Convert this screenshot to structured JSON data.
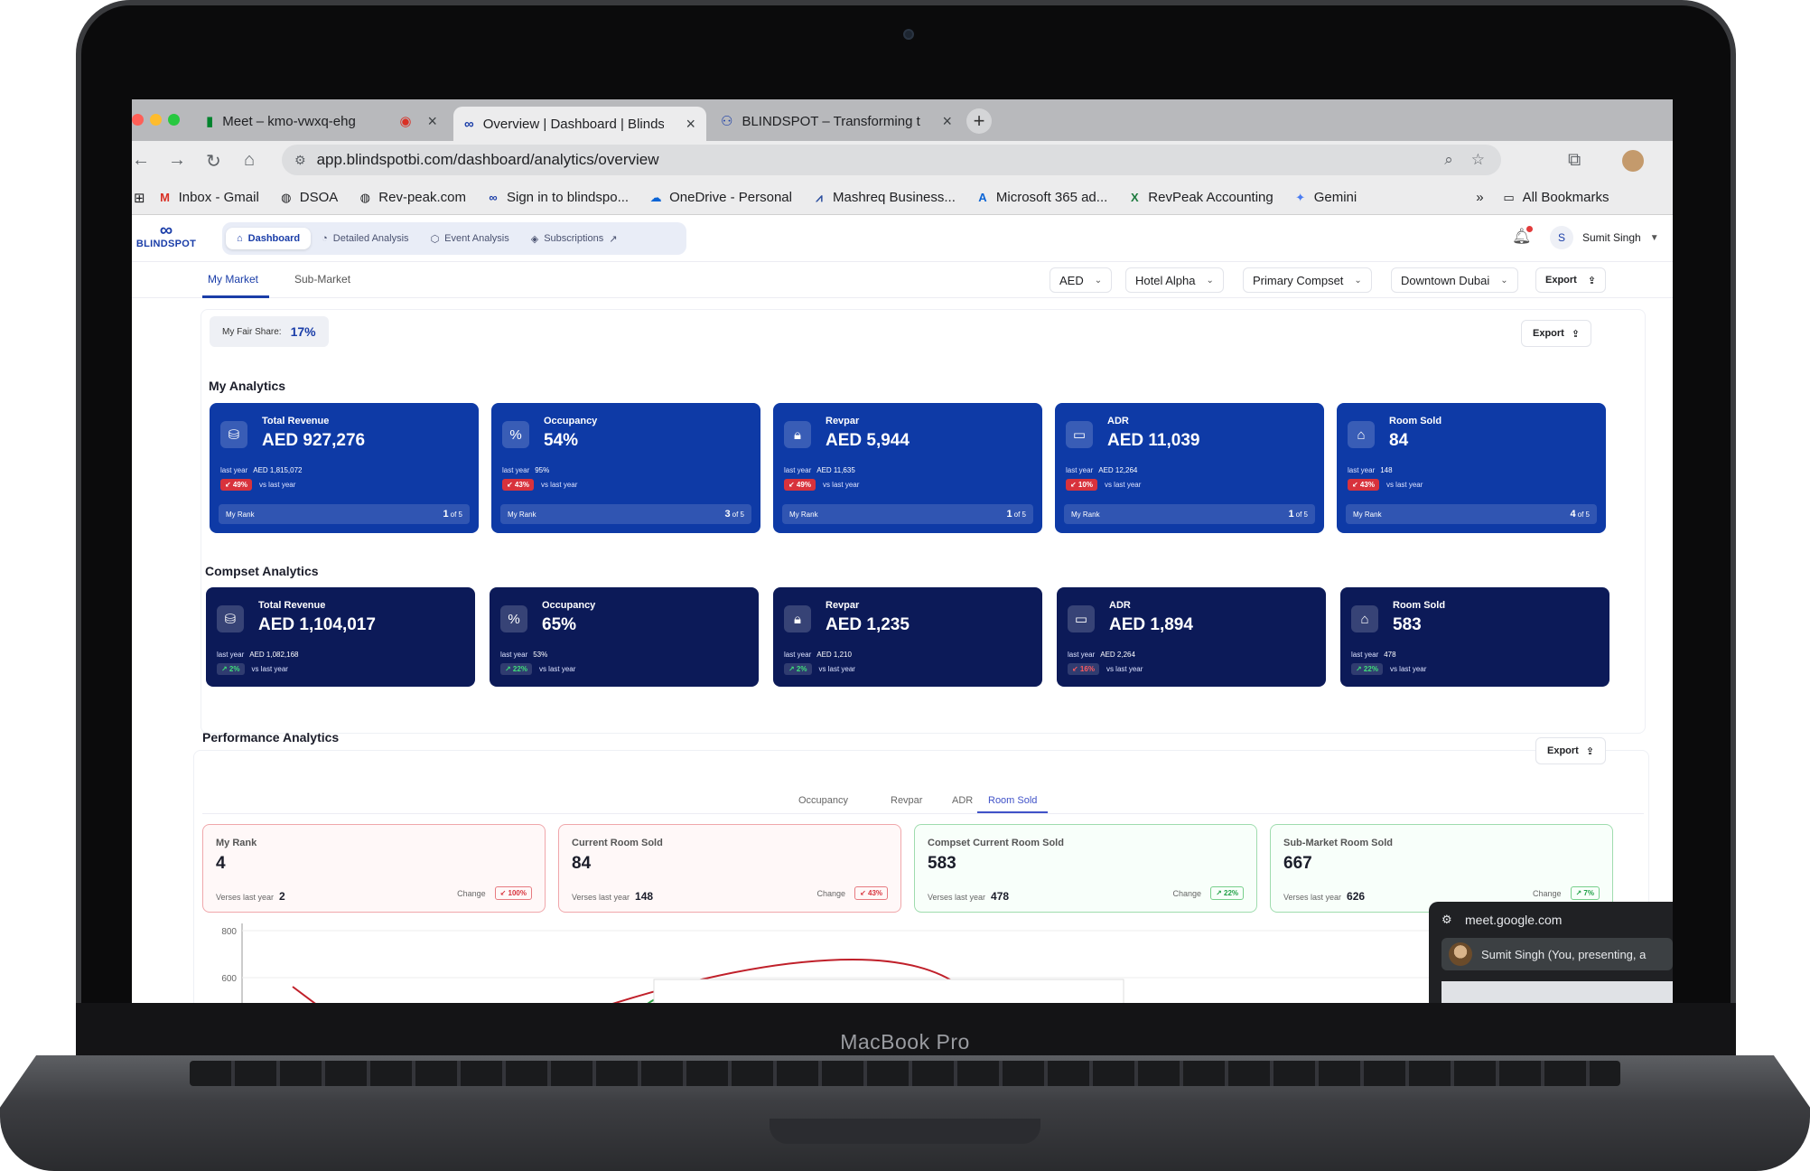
{
  "device": {
    "brand": "MacBook Pro"
  },
  "browser": {
    "tabs": [
      {
        "title": "Meet – kmo-vwxq-ehg",
        "icon": "google-meet-icon"
      },
      {
        "title": "Overview | Dashboard | Blinds",
        "icon": "blindspot-icon"
      },
      {
        "title": "BLINDSPOT – Transforming t",
        "icon": "people-icon"
      }
    ],
    "url": "app.blindspotbi.com/dashboard/analytics/overview",
    "bookmarks": [
      "Inbox - Gmail",
      "DSOA",
      "Rev-peak.com",
      "Sign in to blindspo...",
      "OneDrive - Personal",
      "Mashreq Business...",
      "Microsoft 365 ad...",
      "RevPeak Accounting",
      "Gemini"
    ],
    "all_bookmarks": "All Bookmarks"
  },
  "app": {
    "logo": "BLINDSPOT",
    "nav": [
      "Dashboard",
      "Detailed Analysis",
      "Event Analysis",
      "Subscriptions"
    ],
    "user": {
      "initial": "S",
      "name": "Sumit Singh"
    },
    "subtabs": [
      "My Market",
      "Sub-Market"
    ],
    "filters": [
      "AED",
      "Hotel Alpha",
      "Primary Compset",
      "Downtown Dubai"
    ],
    "export": "Export",
    "fair_share_label": "My Fair Share:",
    "fair_share_value": "17%",
    "colors": {
      "primary": "#0e3aa6",
      "navy": "#0c1a58",
      "red": "#d8323c",
      "green": "#20a046"
    }
  },
  "my_analytics": {
    "title": "My Analytics",
    "cards": [
      {
        "label": "Total Revenue",
        "value": "AED 927,276",
        "ly_label": "last year",
        "ly_value": "AED 1,815,072",
        "change": "↙ 49%",
        "vs": "vs last year",
        "rank_label": "My Rank",
        "rank": "1",
        "rank_of": "of 5",
        "icon": "money-bag-icon"
      },
      {
        "label": "Occupancy",
        "value": "54%",
        "ly_label": "last year",
        "ly_value": "95%",
        "change": "↙ 43%",
        "vs": "vs last year",
        "rank_label": "My Rank",
        "rank": "3",
        "rank_of": "of 5",
        "icon": "percent-icon"
      },
      {
        "label": "Revpar",
        "value": "AED 5,944",
        "ly_label": "last year",
        "ly_value": "AED 11,635",
        "change": "↙ 49%",
        "vs": "vs last year",
        "rank_label": "My Rank",
        "rank": "1",
        "rank_of": "of 5",
        "icon": "bag-icon"
      },
      {
        "label": "ADR",
        "value": "AED 11,039",
        "ly_label": "last year",
        "ly_value": "AED 12,264",
        "change": "↙ 10%",
        "vs": "vs last year",
        "rank_label": "My Rank",
        "rank": "1",
        "rank_of": "of 5",
        "icon": "wallet-icon"
      },
      {
        "label": "Room Sold",
        "value": "84",
        "ly_label": "last year",
        "ly_value": "148",
        "change": "↙ 43%",
        "vs": "vs last year",
        "rank_label": "My Rank",
        "rank": "4",
        "rank_of": "of 5",
        "icon": "hotel-icon"
      }
    ]
  },
  "compset_analytics": {
    "title": "Compset Analytics",
    "cards": [
      {
        "label": "Total Revenue",
        "value": "AED 1,104,017",
        "ly_label": "last year",
        "ly_value": "AED 1,082,168",
        "change": "↗ 2%",
        "trend": "up",
        "vs": "vs last year",
        "icon": "money-bag-icon"
      },
      {
        "label": "Occupancy",
        "value": "65%",
        "ly_label": "last year",
        "ly_value": "53%",
        "change": "↗ 22%",
        "trend": "up",
        "vs": "vs last year",
        "icon": "percent-icon"
      },
      {
        "label": "Revpar",
        "value": "AED 1,235",
        "ly_label": "last year",
        "ly_value": "AED 1,210",
        "change": "↗ 2%",
        "trend": "up",
        "vs": "vs last year",
        "icon": "bag-icon"
      },
      {
        "label": "ADR",
        "value": "AED 1,894",
        "ly_label": "last year",
        "ly_value": "AED 2,264",
        "change": "↙ 16%",
        "trend": "down",
        "vs": "vs last year",
        "icon": "wallet-icon"
      },
      {
        "label": "Room Sold",
        "value": "583",
        "ly_label": "last year",
        "ly_value": "478",
        "change": "↗ 22%",
        "trend": "up",
        "vs": "vs last year",
        "icon": "hotel-icon"
      }
    ]
  },
  "performance": {
    "title": "Performance Analytics",
    "tabs": [
      "Occupancy",
      "Revpar",
      "ADR",
      "Room Sold"
    ],
    "active_tab": "Room Sold",
    "cards": [
      {
        "label": "My Rank",
        "value": "4",
        "vs_label": "Verses last year",
        "vs_value": "2",
        "change_label": "Change",
        "change": "↙ 100%",
        "tone": "red"
      },
      {
        "label": "Current Room Sold",
        "value": "84",
        "vs_label": "Verses last year",
        "vs_value": "148",
        "change_label": "Change",
        "change": "↙ 43%",
        "tone": "red"
      },
      {
        "label": "Compset Current Room Sold",
        "value": "583",
        "vs_label": "Verses last year",
        "vs_value": "478",
        "change_label": "Change",
        "change": "↗ 22%",
        "tone": "green"
      },
      {
        "label": "Sub-Market Room Sold",
        "value": "667",
        "vs_label": "Verses last year",
        "vs_value": "626",
        "change_label": "Change",
        "change": "↗ 7%",
        "tone": "green"
      }
    ],
    "chart_ticks": [
      "800",
      "600"
    ]
  },
  "meet_popup": {
    "url": "meet.google.com",
    "presenting": "Sumit Singh (You, presenting, a"
  }
}
